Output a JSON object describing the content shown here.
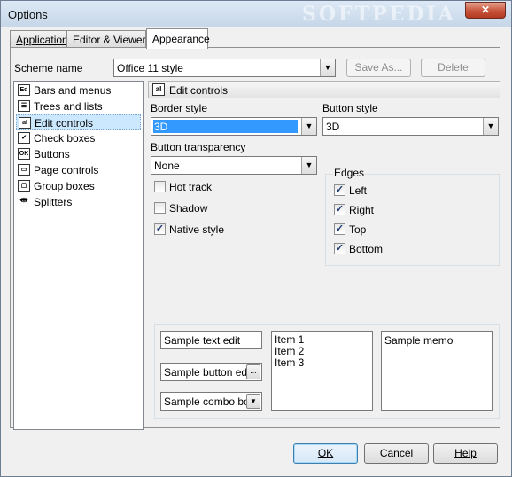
{
  "window": {
    "title": "Options",
    "close_glyph": "✕",
    "watermark": "SOFTPEDIA"
  },
  "tabs": [
    {
      "label": "Application",
      "active": false
    },
    {
      "label": "Editor & Viewers",
      "active": false
    },
    {
      "label": "Appearance",
      "active": true
    }
  ],
  "scheme": {
    "label": "Scheme name",
    "value": "Office 11 style",
    "save_as_label": "Save As...",
    "delete_label": "Delete"
  },
  "nav": {
    "items": [
      {
        "label": "Bars and menus",
        "icon": "bars-menus-icon",
        "selected": false
      },
      {
        "label": "Trees and lists",
        "icon": "tree-list-icon",
        "selected": false
      },
      {
        "label": "Edit controls",
        "icon": "edit-controls-icon",
        "selected": true
      },
      {
        "label": "Check boxes",
        "icon": "checkbox-icon",
        "selected": false
      },
      {
        "label": "Buttons",
        "icon": "button-icon",
        "selected": false
      },
      {
        "label": "Page controls",
        "icon": "page-controls-icon",
        "selected": false
      },
      {
        "label": "Group boxes",
        "icon": "group-box-icon",
        "selected": false
      },
      {
        "label": "Splitters",
        "icon": "splitter-icon",
        "selected": false
      }
    ]
  },
  "panel": {
    "header": "Edit controls",
    "border_style": {
      "label": "Border style",
      "value": "3D"
    },
    "button_style": {
      "label": "Button style",
      "value": "3D"
    },
    "button_transparency": {
      "label": "Button transparency",
      "value": "None"
    },
    "options": [
      {
        "label": "Hot track",
        "checked": false
      },
      {
        "label": "Shadow",
        "checked": false
      },
      {
        "label": "Native style",
        "checked": true
      }
    ],
    "edges": {
      "label": "Edges",
      "items": [
        {
          "label": "Left",
          "checked": true
        },
        {
          "label": "Right",
          "checked": true
        },
        {
          "label": "Top",
          "checked": true
        },
        {
          "label": "Bottom",
          "checked": true
        }
      ]
    },
    "samples": {
      "text_edit": "Sample text edit",
      "button_edit": "Sample button edit",
      "button_edit_glyph": "...",
      "combo_box": "Sample combo box",
      "list_items": [
        "Item 1",
        "Item 2",
        "Item 3"
      ],
      "memo": "Sample memo"
    }
  },
  "footer": {
    "ok_label": "OK",
    "cancel_label": "Cancel",
    "help_label": "Help"
  },
  "colors": {
    "selection": "#3399ff",
    "nav_selected": "#cce8ff",
    "close_button": "#c6523a"
  }
}
